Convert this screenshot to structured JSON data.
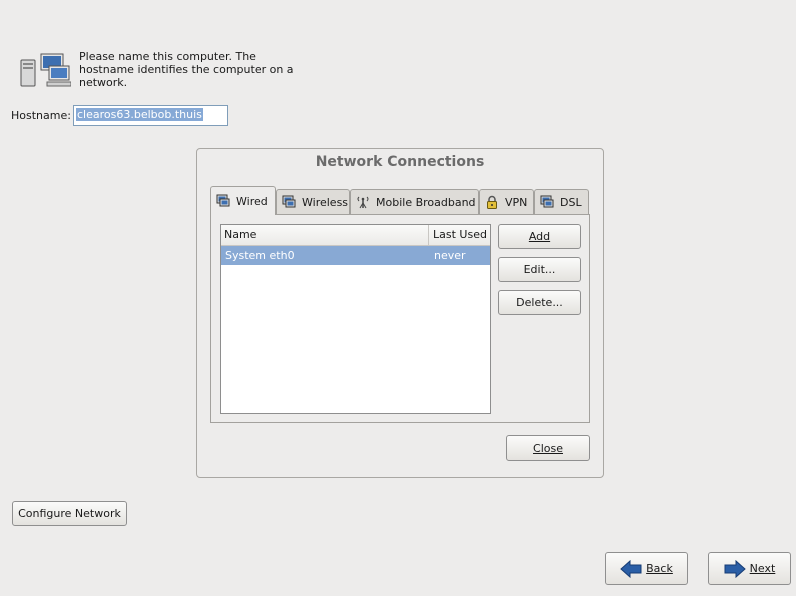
{
  "intro": {
    "text": "Please name this computer.  The hostname identifies the computer on a network.",
    "icon": "network-computer-icon"
  },
  "hostname": {
    "label": "Hostname:",
    "value": "clearos63.belbob.thuis"
  },
  "network_dialog": {
    "title": "Network Connections",
    "tabs": [
      {
        "label": "Wired",
        "icon": "wired-icon",
        "active": true
      },
      {
        "label": "Wireless",
        "icon": "wireless-icon",
        "active": false
      },
      {
        "label": "Mobile Broadband",
        "icon": "antenna-icon",
        "active": false
      },
      {
        "label": "VPN",
        "icon": "lock-icon",
        "active": false
      },
      {
        "label": "DSL",
        "icon": "dsl-icon",
        "active": false
      }
    ],
    "columns": [
      "Name",
      "Last Used"
    ],
    "connections": [
      {
        "name": "System eth0",
        "last_used": "never",
        "selected": true
      }
    ],
    "buttons": {
      "add": "Add",
      "edit": "Edit...",
      "delete": "Delete..."
    },
    "close_label": "Close"
  },
  "configure_network_label": "Configure Network",
  "nav": {
    "back_label": "Back",
    "next_label": "Next"
  },
  "colors": {
    "background": "#edeceb",
    "selection": "#88a9d4",
    "arrow": "#2a5ea6"
  }
}
